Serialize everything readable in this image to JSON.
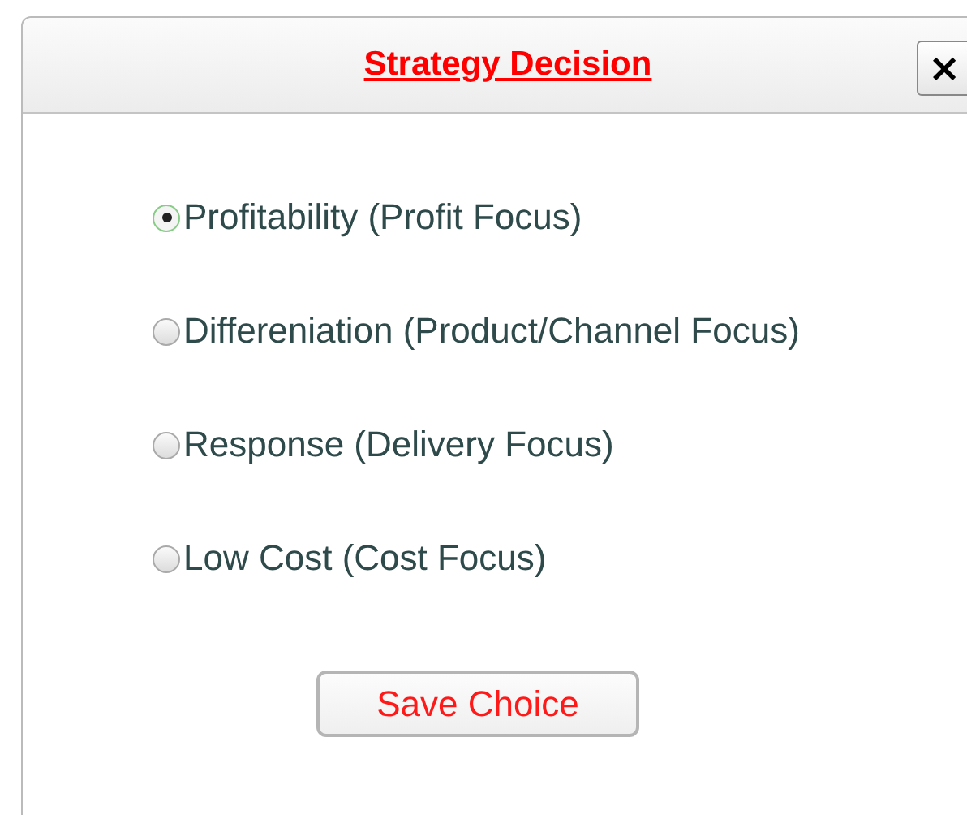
{
  "dialog": {
    "title": "Strategy Decision",
    "close": "×"
  },
  "options": [
    {
      "label": "Profitability (Profit Focus)",
      "selected": true
    },
    {
      "label": "Differeniation (Product/Channel Focus)",
      "selected": false
    },
    {
      "label": "Response (Delivery Focus)",
      "selected": false
    },
    {
      "label": "Low Cost (Cost Focus)",
      "selected": false
    }
  ],
  "button": "Save Choice"
}
